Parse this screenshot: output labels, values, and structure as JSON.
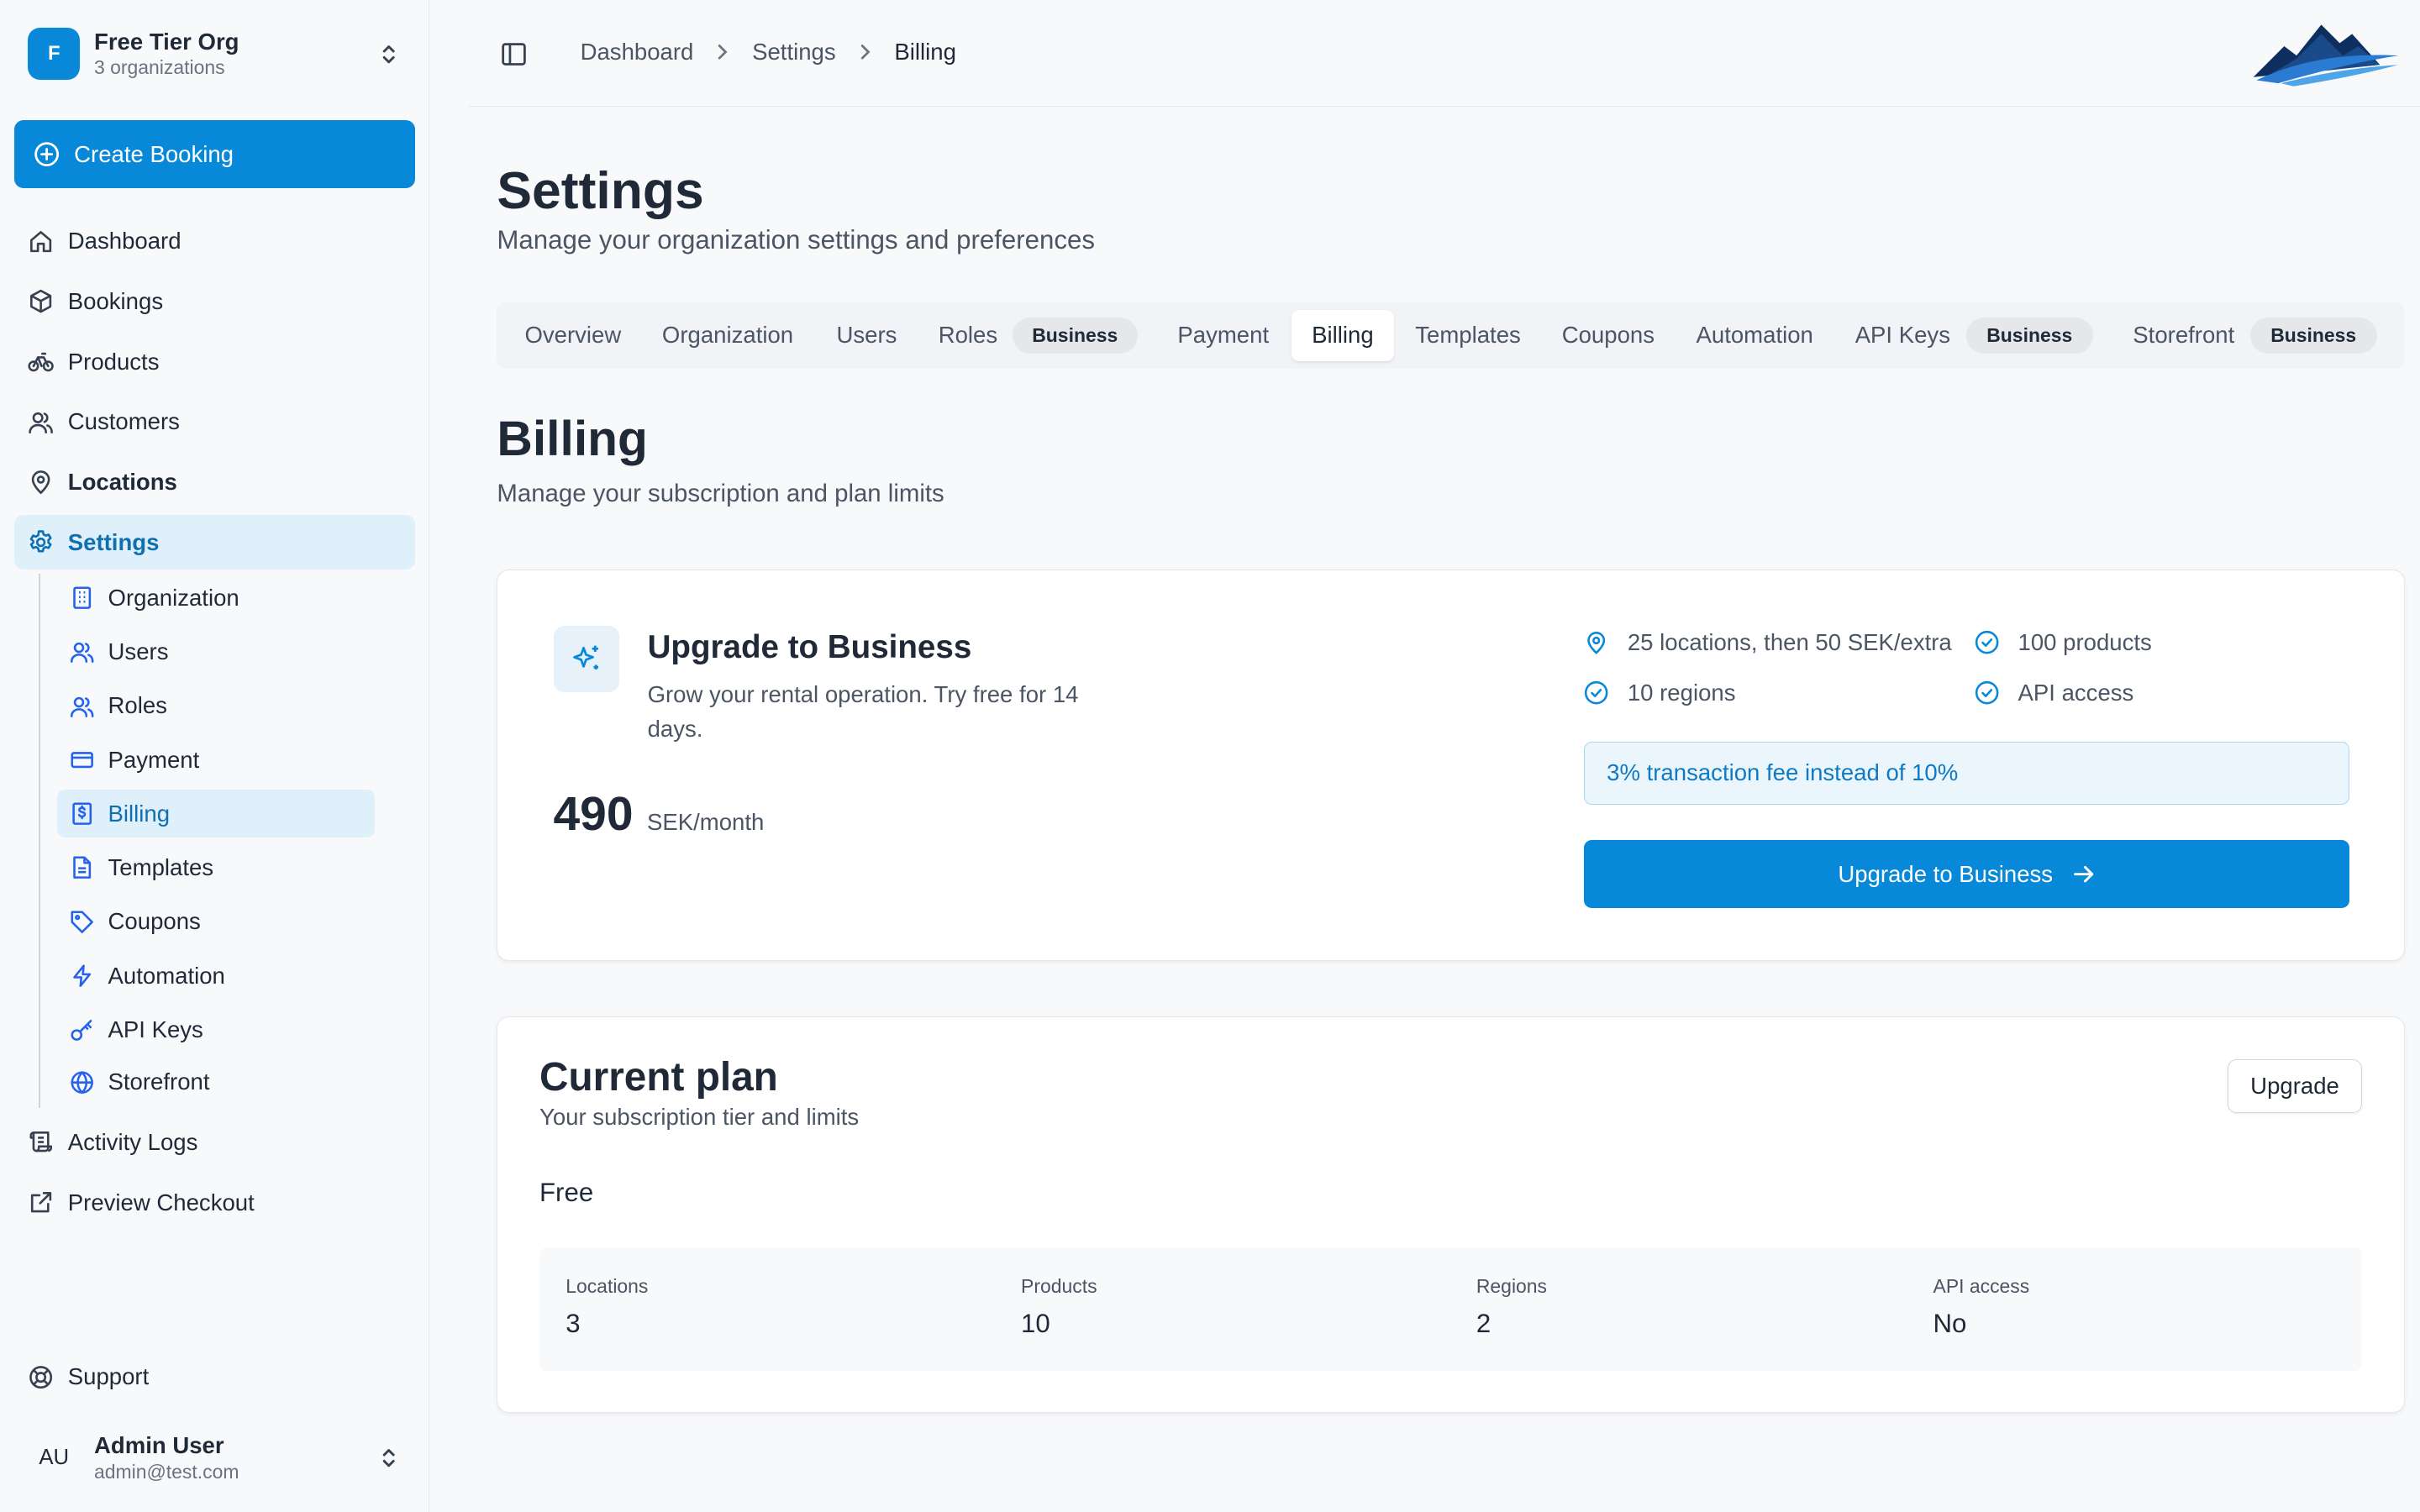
{
  "sidebar": {
    "org_initial": "F",
    "org_name": "Free Tier Org",
    "org_sub": "3 organizations",
    "create_label": "Create Booking",
    "nav": {
      "dashboard": "Dashboard",
      "bookings": "Bookings",
      "products": "Products",
      "customers": "Customers",
      "locations": "Locations",
      "settings": "Settings",
      "activity_logs": "Activity Logs",
      "preview_checkout": "Preview Checkout",
      "support": "Support"
    },
    "settings_sub": {
      "organization": "Organization",
      "users": "Users",
      "roles": "Roles",
      "payment": "Payment",
      "billing": "Billing",
      "templates": "Templates",
      "coupons": "Coupons",
      "automation": "Automation",
      "api_keys": "API Keys",
      "storefront": "Storefront"
    },
    "user_initials": "AU",
    "user_name": "Admin User",
    "user_email": "admin@test.com"
  },
  "breadcrumb": [
    "Dashboard",
    "Settings",
    "Billing"
  ],
  "page": {
    "title": "Settings",
    "subtitle": "Manage your organization settings and preferences"
  },
  "tabs": {
    "overview": "Overview",
    "organization": "Organization",
    "users": "Users",
    "roles": "Roles",
    "payment": "Payment",
    "billing": "Billing",
    "templates": "Templates",
    "coupons": "Coupons",
    "automation": "Automation",
    "api_keys": "API Keys",
    "storefront": "Storefront",
    "badge": "Business"
  },
  "billing": {
    "title": "Billing",
    "subtitle": "Manage your subscription and plan limits",
    "upgrade": {
      "title": "Upgrade to Business",
      "description": "Grow your rental operation. Try free for 14 days.",
      "price": "490",
      "price_unit": "SEK/month",
      "features": {
        "locations": "25 locations, then 50 SEK/extra",
        "products": "100 products",
        "regions": "10 regions",
        "api": "API access"
      },
      "fee_note": "3% transaction fee instead of 10%",
      "button": "Upgrade to Business"
    },
    "current_plan": {
      "title": "Current plan",
      "subtitle": "Your subscription tier and limits",
      "button": "Upgrade",
      "plan_name": "Free",
      "limits": {
        "locations": {
          "label": "Locations",
          "value": "3"
        },
        "products": {
          "label": "Products",
          "value": "10"
        },
        "regions": {
          "label": "Regions",
          "value": "2"
        },
        "api": {
          "label": "API access",
          "value": "No"
        }
      }
    }
  },
  "colors": {
    "accent": "#0788d8",
    "active_bg": "#e0f0fb",
    "active_text": "#0f6fb0"
  }
}
